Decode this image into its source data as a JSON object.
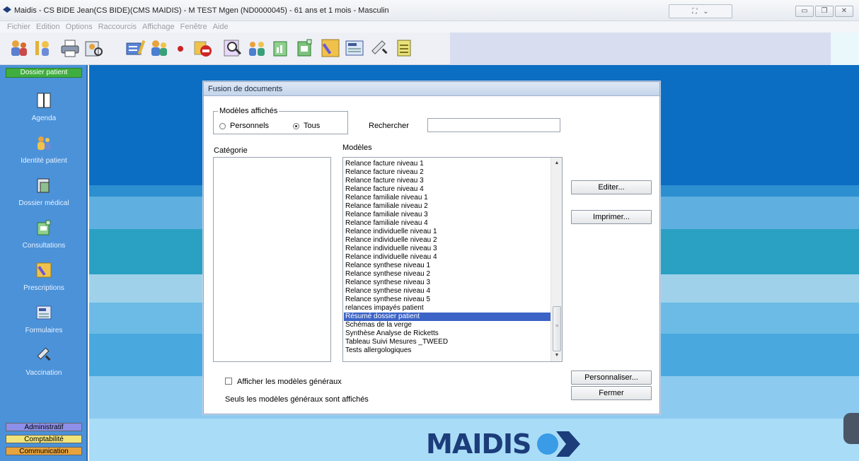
{
  "window": {
    "title": "Maidis - CS BIDE Jean(CS BIDE)(CMS MAIDIS) - M TEST Mgen (ND0000045) - 61 ans et 1 mois - Masculin"
  },
  "menu": [
    "Fichier",
    "Edition",
    "Options",
    "Raccourcis",
    "Affichage",
    "Fenêtre",
    "Aide"
  ],
  "toolbar": {
    "icons": [
      "users-gear-icon",
      "key-users-icon",
      "printer-icon",
      "patient-search-icon",
      "card-edit-icon",
      "patients-icon",
      "record-dot-icon",
      "no-entry-icon",
      "magnifier-icon",
      "group-icon",
      "chart-doc-icon",
      "chart-doc2-icon",
      "prescription-icon",
      "form-icon",
      "syringe-icon",
      "note-icon"
    ]
  },
  "sidebar": {
    "header": "Dossier patient",
    "items": [
      {
        "label": "Agenda",
        "icon": "book-icon"
      },
      {
        "label": "Identité patient",
        "icon": "identity-icon"
      },
      {
        "label": "Dossier médical",
        "icon": "medical-file-icon"
      },
      {
        "label": "Consultations",
        "icon": "consultation-icon"
      },
      {
        "label": "Prescriptions",
        "icon": "prescription-icon"
      },
      {
        "label": "Formulaires",
        "icon": "form-icon"
      },
      {
        "label": "Vaccination",
        "icon": "syringe-icon"
      }
    ],
    "bottom": [
      {
        "label": "Administratif",
        "color": "#8e8fe8"
      },
      {
        "label": "Comptabilité",
        "color": "#f0e37a"
      },
      {
        "label": "Communication",
        "color": "#e8a33d"
      }
    ]
  },
  "dialog": {
    "title": "Fusion de documents",
    "group_label": "Modèles affichés",
    "radio_personnels": "Personnels",
    "radio_tous": "Tous",
    "search_label": "Rechercher",
    "search_value": "",
    "category_label": "Catégorie",
    "models_label": "Modèles",
    "models": [
      "Relance facture niveau 1",
      "Relance facture niveau 2",
      "Relance facture niveau 3",
      "Relance facture niveau 4",
      "Relance familiale niveau 1",
      "Relance familiale niveau 2",
      "Relance familiale niveau 3",
      "Relance familiale niveau 4",
      "Relance individuelle niveau 1",
      "Relance individuelle niveau 2",
      "Relance individuelle niveau 3",
      "Relance individuelle niveau 4",
      "Relance synthese niveau 1",
      "Relance synthese niveau 2",
      "Relance synthese niveau 3",
      "Relance synthese niveau 4",
      "Relance synthese niveau 5",
      "relances impayés patient",
      "Résumé dossier patient",
      "Schémas de la verge",
      "Synthèse Analyse de Ricketts",
      "Tableau Suivi Mesures _TWEED",
      "Tests allergologiques"
    ],
    "selected_model": "Résumé dossier patient",
    "btn_edit": "Editer...",
    "btn_print": "Imprimer...",
    "btn_customize": "Personnaliser...",
    "btn_close": "Fermer",
    "checkbox_label": "Afficher les modèles généraux",
    "status_text": "Seuls les modèles généraux sont affichés"
  },
  "logo": {
    "text": "MAIDIS"
  },
  "colors": {
    "accent": "#1c3c7a",
    "selection": "#3c64c6",
    "sidebar": "#4b92d9"
  }
}
